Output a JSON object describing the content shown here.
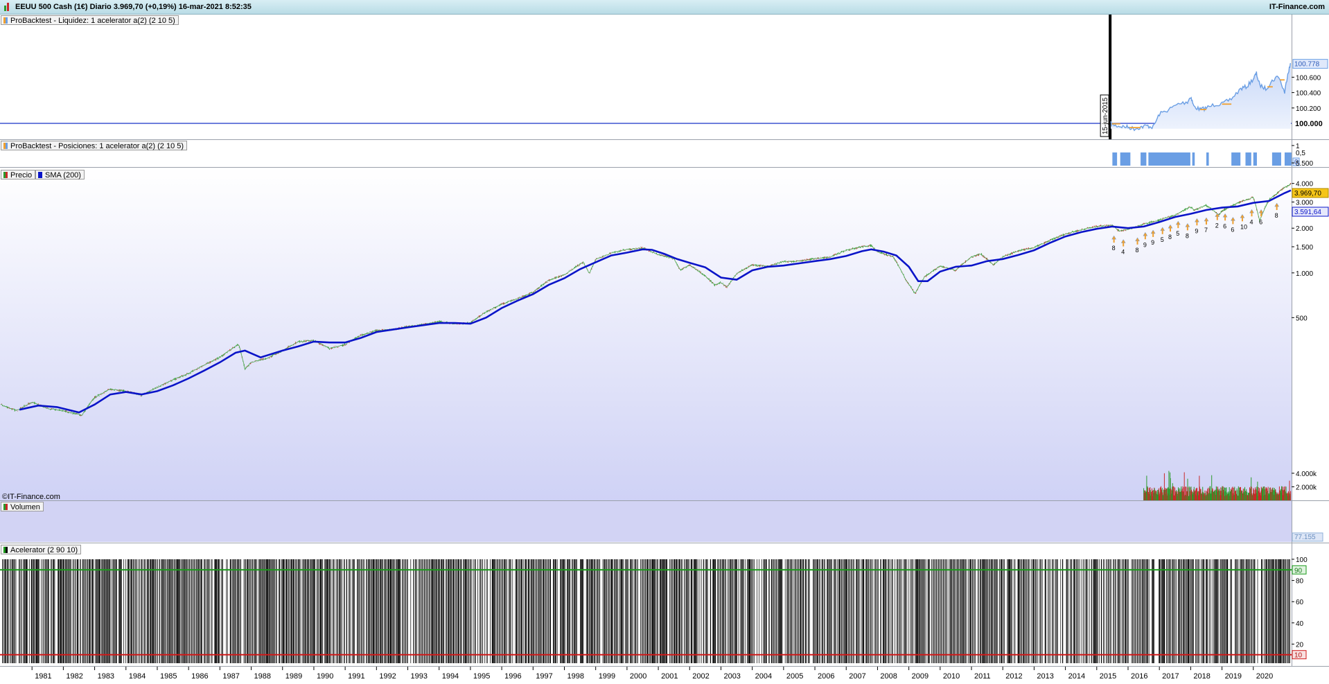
{
  "header": {
    "title": "EEUU 500 Cash (1€) Diario 3.969,70 (+0,19%) 16-mar-2021 8:52:35",
    "brand": "IT-Finance.com"
  },
  "copyright": "©IT-Finance.com",
  "colors": {
    "sma": "#0a14c8",
    "equity": "#6a9ee4",
    "equity_highlight": "#f0a030",
    "up": "#2a9a2a",
    "down": "#c82828",
    "overbought": "#1a9a1a",
    "oversold": "#d01818",
    "buy_arrow": "#f0a030"
  },
  "panels": {
    "equity": {
      "label": "ProBacktest - Liquidez: 1  acelerator a(2) (2 10 5)",
      "ticks": [
        "100.600",
        "100.400",
        "100.200"
      ],
      "baseline": "100.000",
      "last": "100.778",
      "start_marker": "15-jun-2015"
    },
    "positions": {
      "label": "ProBacktest - Posiciones: 1  acelerator a(2) (2 10 5)",
      "ticks": [
        "1",
        "0,5"
      ],
      "last": "0"
    },
    "price": {
      "label_price": "Precio",
      "label_sma": "SMA (200)",
      "ticks": [
        "5.500",
        "4.000",
        "3.000",
        "2.000",
        "1.500",
        "1.000",
        "500"
      ],
      "last_price": "3.969,70",
      "last_sma": "3.591,64",
      "signal_labels": [
        "8",
        "4",
        "8",
        "9",
        "9",
        "5",
        "8",
        "5",
        "8",
        "9",
        "7",
        "2",
        "6",
        "6",
        "10",
        "4",
        "6",
        "8"
      ]
    },
    "volume": {
      "label": "Volumen",
      "ticks": [
        "4.000k",
        "2.000k"
      ],
      "last": "77.155"
    },
    "accelerator": {
      "label": "Acelerator (2 90 10)",
      "ticks": [
        "100",
        "80",
        "60",
        "40",
        "20"
      ],
      "upper": "90",
      "lower": "10"
    }
  },
  "x_axis": {
    "years": [
      "1981",
      "1982",
      "1983",
      "1984",
      "1985",
      "1986",
      "1987",
      "1988",
      "1989",
      "1990",
      "1991",
      "1992",
      "1993",
      "1994",
      "1995",
      "1996",
      "1997",
      "1998",
      "1999",
      "2000",
      "2001",
      "2002",
      "2003",
      "2004",
      "2005",
      "2006",
      "2007",
      "2008",
      "2009",
      "2010",
      "2011",
      "2012",
      "2013",
      "2014",
      "2015",
      "2016",
      "2017",
      "2018",
      "2019",
      "2020"
    ]
  },
  "chart_data": [
    {
      "type": "line",
      "title": "EEUU 500 Cash (1€) Diario",
      "log_scale": true,
      "series": [
        {
          "name": "Precio",
          "x": [
            1980.0,
            1980.5,
            1981.0,
            1981.5,
            1982.0,
            1982.6,
            1983.0,
            1983.5,
            1984.0,
            1984.5,
            1985.0,
            1985.5,
            1986.0,
            1986.5,
            1987.0,
            1987.6,
            1987.8,
            1988.0,
            1988.5,
            1989.0,
            1989.5,
            1990.0,
            1990.5,
            1990.8,
            1991.0,
            1991.5,
            1992.0,
            1992.5,
            1993.0,
            1993.5,
            1994.0,
            1994.5,
            1995.0,
            1995.5,
            1996.0,
            1996.5,
            1997.0,
            1997.5,
            1998.0,
            1998.6,
            1998.8,
            1999.0,
            1999.5,
            2000.0,
            2000.5,
            2000.8,
            2001.0,
            2001.5,
            2001.7,
            2002.0,
            2002.5,
            2002.8,
            2003.0,
            2003.2,
            2003.5,
            2004.0,
            2004.5,
            2005.0,
            2005.5,
            2006.0,
            2006.5,
            2007.0,
            2007.5,
            2007.8,
            2008.0,
            2008.5,
            2008.9,
            2009.2,
            2009.5,
            2010.0,
            2010.5,
            2011.0,
            2011.3,
            2011.7,
            2012.0,
            2012.5,
            2013.0,
            2013.5,
            2014.0,
            2014.5,
            2015.0,
            2015.5,
            2015.7,
            2016.0,
            2016.5,
            2017.0,
            2017.5,
            2018.0,
            2018.1,
            2018.5,
            2018.9,
            2019.0,
            2019.5,
            2020.0,
            2020.2,
            2020.5,
            2021.0,
            2021.2
          ],
          "y": [
            130,
            118,
            135,
            122,
            118,
            110,
            145,
            165,
            160,
            150,
            170,
            190,
            210,
            240,
            270,
            330,
            225,
            250,
            265,
            300,
            345,
            350,
            310,
            320,
            330,
            380,
            410,
            415,
            435,
            450,
            470,
            455,
            460,
            545,
            615,
            670,
            740,
            890,
            970,
            1180,
            990,
            1230,
            1360,
            1440,
            1470,
            1390,
            1330,
            1240,
            1040,
            1130,
            950,
            830,
            860,
            800,
            990,
            1130,
            1110,
            1190,
            1200,
            1250,
            1280,
            1420,
            1500,
            1530,
            1390,
            1280,
            900,
            720,
            940,
            1110,
            1040,
            1280,
            1340,
            1130,
            1280,
            1410,
            1480,
            1650,
            1830,
            1950,
            2060,
            2100,
            1920,
            1960,
            2130,
            2270,
            2440,
            2790,
            2640,
            2850,
            2450,
            2610,
            2950,
            3230,
            2240,
            3100,
            3750,
            3969.7
          ]
        },
        {
          "name": "SMA (200)",
          "x": [
            1980.6,
            1981.2,
            1981.8,
            1982.5,
            1983.0,
            1983.5,
            1984.0,
            1984.5,
            1985.0,
            1985.5,
            1986.0,
            1986.5,
            1987.0,
            1987.5,
            1987.8,
            1988.3,
            1989.0,
            1989.5,
            1990.0,
            1990.5,
            1991.0,
            1991.5,
            1992.0,
            1992.5,
            1993.0,
            1993.5,
            1994.0,
            1994.5,
            1995.0,
            1995.5,
            1996.0,
            1996.5,
            1997.0,
            1997.5,
            1998.0,
            1998.5,
            1999.0,
            1999.5,
            2000.0,
            2000.5,
            2000.8,
            2001.2,
            2001.6,
            2002.0,
            2002.5,
            2003.0,
            2003.5,
            2004.0,
            2004.5,
            2005.0,
            2005.5,
            2006.0,
            2006.5,
            2007.0,
            2007.5,
            2007.8,
            2008.2,
            2008.6,
            2009.0,
            2009.3,
            2009.6,
            2010.0,
            2010.5,
            2011.0,
            2011.5,
            2012.0,
            2012.5,
            2013.0,
            2013.5,
            2014.0,
            2014.5,
            2015.0,
            2015.5,
            2016.0,
            2016.5,
            2017.0,
            2017.5,
            2018.0,
            2018.5,
            2019.0,
            2019.5,
            2020.0,
            2020.5,
            2021.0,
            2021.2
          ],
          "y": [
            120,
            128,
            125,
            115,
            130,
            152,
            158,
            152,
            160,
            175,
            195,
            220,
            250,
            290,
            300,
            270,
            300,
            320,
            345,
            340,
            340,
            365,
            400,
            415,
            430,
            445,
            460,
            460,
            455,
            500,
            580,
            650,
            720,
            830,
            920,
            1060,
            1180,
            1310,
            1370,
            1440,
            1430,
            1340,
            1240,
            1170,
            1090,
            930,
            900,
            1040,
            1100,
            1120,
            1160,
            1200,
            1240,
            1300,
            1400,
            1440,
            1390,
            1310,
            1100,
            880,
            880,
            1020,
            1100,
            1120,
            1200,
            1240,
            1320,
            1420,
            1590,
            1760,
            1880,
            1980,
            2050,
            2000,
            2050,
            2200,
            2380,
            2500,
            2650,
            2750,
            2800,
            2960,
            3050,
            3450,
            3591.64
          ]
        },
        {
          "name": "ProBacktest - Liquidez",
          "x": [
            2015.45,
            2015.6,
            2015.8,
            2016.0,
            2016.2,
            2016.4,
            2016.6,
            2016.8,
            2017.0,
            2017.3,
            2017.6,
            2017.9,
            2018.0,
            2018.1,
            2018.3,
            2018.5,
            2018.8,
            2019.0,
            2019.3,
            2019.6,
            2019.8,
            2020.0,
            2020.1,
            2020.2,
            2020.4,
            2020.6,
            2020.8,
            2021.0,
            2021.1,
            2021.2
          ],
          "y": [
            100.0,
            99.97,
            99.96,
            99.95,
            99.93,
            99.95,
            99.97,
            99.95,
            100.12,
            100.18,
            100.25,
            100.28,
            100.35,
            100.22,
            100.18,
            100.2,
            100.25,
            100.25,
            100.32,
            100.45,
            100.48,
            100.58,
            100.65,
            100.5,
            100.45,
            100.55,
            100.62,
            100.4,
            100.65,
            100.778
          ]
        }
      ],
      "ylim": [
        100,
        5500
      ]
    },
    {
      "type": "bar",
      "title": "Volumen",
      "x_range": [
        2016.5,
        2021.2
      ],
      "ylim": [
        0,
        4500000
      ]
    },
    {
      "type": "line",
      "title": "Acelerator (2 90 10)",
      "ylim": [
        0,
        100
      ],
      "thresholds": [
        90,
        10
      ]
    }
  ]
}
